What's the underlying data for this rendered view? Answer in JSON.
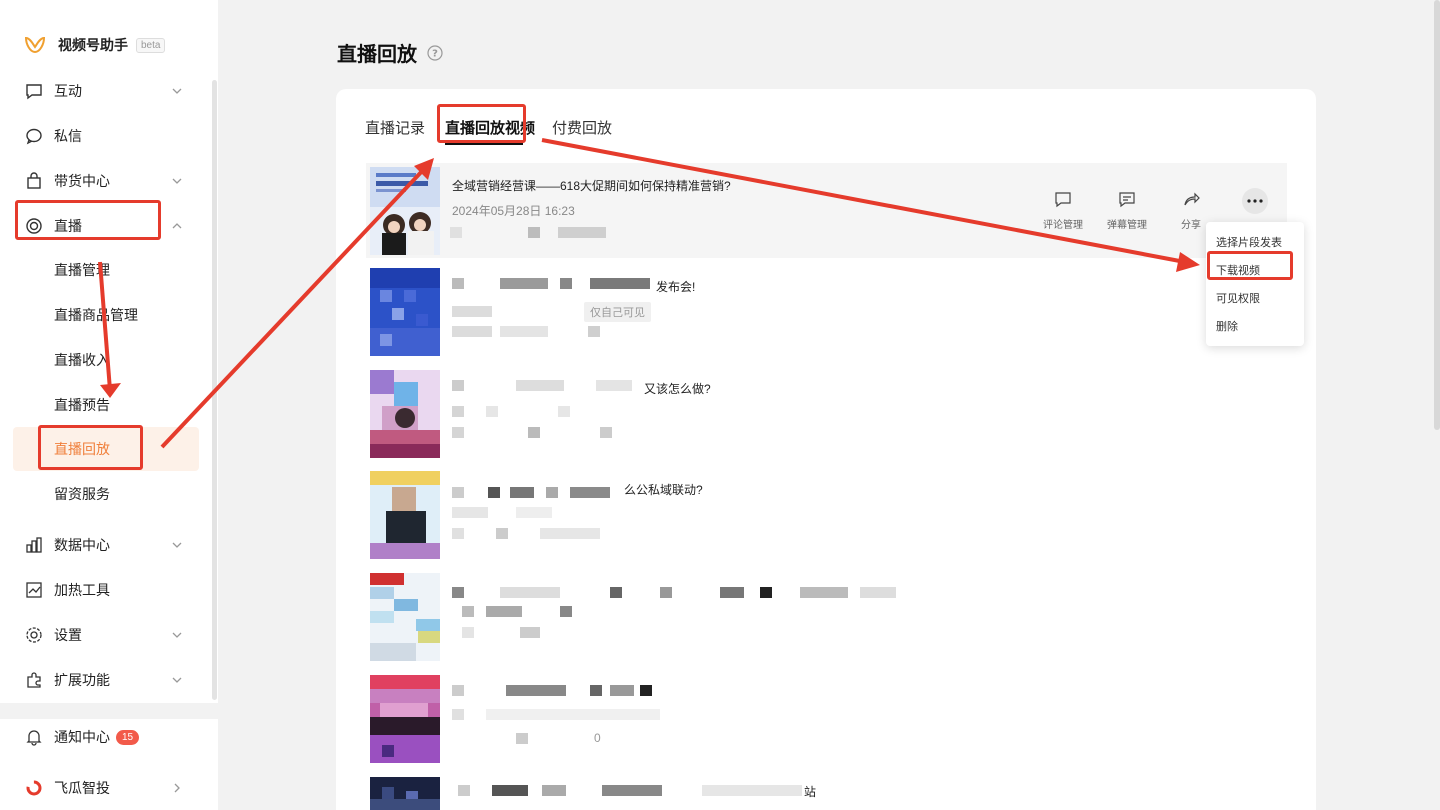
{
  "app": {
    "name": "视频号助手",
    "beta": "beta"
  },
  "sidebar": {
    "items": [
      {
        "label": "互动",
        "icon": "comment-icon"
      },
      {
        "label": "私信",
        "icon": "chat-icon"
      },
      {
        "label": "带货中心",
        "icon": "shopping-bag-icon"
      },
      {
        "label": "直播",
        "icon": "live-icon"
      },
      {
        "label": "数据中心",
        "icon": "bar-chart-icon"
      },
      {
        "label": "加热工具",
        "icon": "trend-icon"
      },
      {
        "label": "设置",
        "icon": "gear-icon"
      },
      {
        "label": "扩展功能",
        "icon": "puzzle-icon"
      }
    ],
    "live_sub": [
      "直播管理",
      "直播商品管理",
      "直播收入",
      "直播预告",
      "直播回放",
      "留资服务"
    ],
    "notify": {
      "label": "通知中心",
      "count": "15"
    },
    "feigua": "飞瓜智投"
  },
  "page": {
    "title": "直播回放"
  },
  "tabs": [
    "直播记录",
    "直播回放视频",
    "付费回放"
  ],
  "rows": [
    {
      "title": "全域营销经营课——618大促期间如何保持精准营销?",
      "time": "2024年05月28日 16:23"
    },
    {
      "title": "发布会!",
      "tag": "仅自己可见"
    },
    {
      "title": "又该怎么做?"
    },
    {
      "title": "么公私域联动?"
    },
    {
      "title": ""
    },
    {
      "title": "",
      "extra": "0"
    },
    {
      "title": "站"
    }
  ],
  "actions": {
    "comment": "评论管理",
    "danmaku": "弹幕管理",
    "share": "分享"
  },
  "dropdown": [
    "选择片段发表",
    "下载视频",
    "可见权限",
    "删除"
  ],
  "colors": {
    "accent": "#f0803c",
    "highlight": "#e53b2c"
  }
}
